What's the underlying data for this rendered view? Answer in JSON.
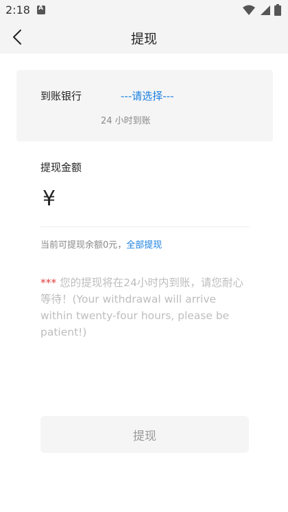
{
  "status_bar": {
    "time": "2:18"
  },
  "header": {
    "title": "提现"
  },
  "bank": {
    "label": "到账银行",
    "select_text": "---请选择---",
    "note": "24 小时到账"
  },
  "amount": {
    "label": "提现金额",
    "currency_symbol": "¥",
    "value": ""
  },
  "balance": {
    "text": "当前可提现余额0元，",
    "withdraw_all": "全部提现"
  },
  "notice": {
    "stars": "***",
    "text": " 您的提现将在24小时内到账，请您耐心等待！(Your withdrawal will arrive within twenty-four hours, please be patient!)"
  },
  "submit": {
    "label": "提现"
  },
  "colors": {
    "accent": "#1a7fe0",
    "warning": "#e04040",
    "background": "#f4f4f4"
  }
}
